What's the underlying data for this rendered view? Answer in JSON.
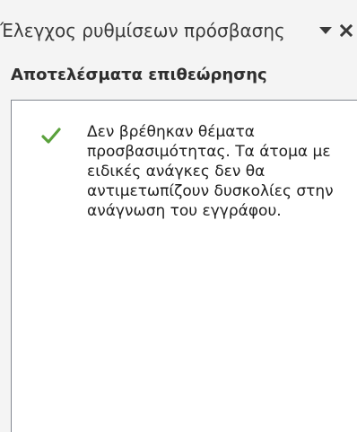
{
  "pane": {
    "title": "Έλεγχος ρυθμίσεων πρόσβασης",
    "dropdown_icon": "triangle-down-icon",
    "close_icon": "close-icon"
  },
  "results": {
    "heading": "Αποτελέσματα επιθεώρησης",
    "status_icon": "checkmark-icon",
    "status_color": "#5aa13c",
    "message": "Δεν βρέθηκαν θέματα προσβασιμότητας. Τα άτομα με ειδικές ανάγκες δεν θα αντιμετωπίζουν δυσκολίες στην ανάγνωση του εγγράφου."
  }
}
